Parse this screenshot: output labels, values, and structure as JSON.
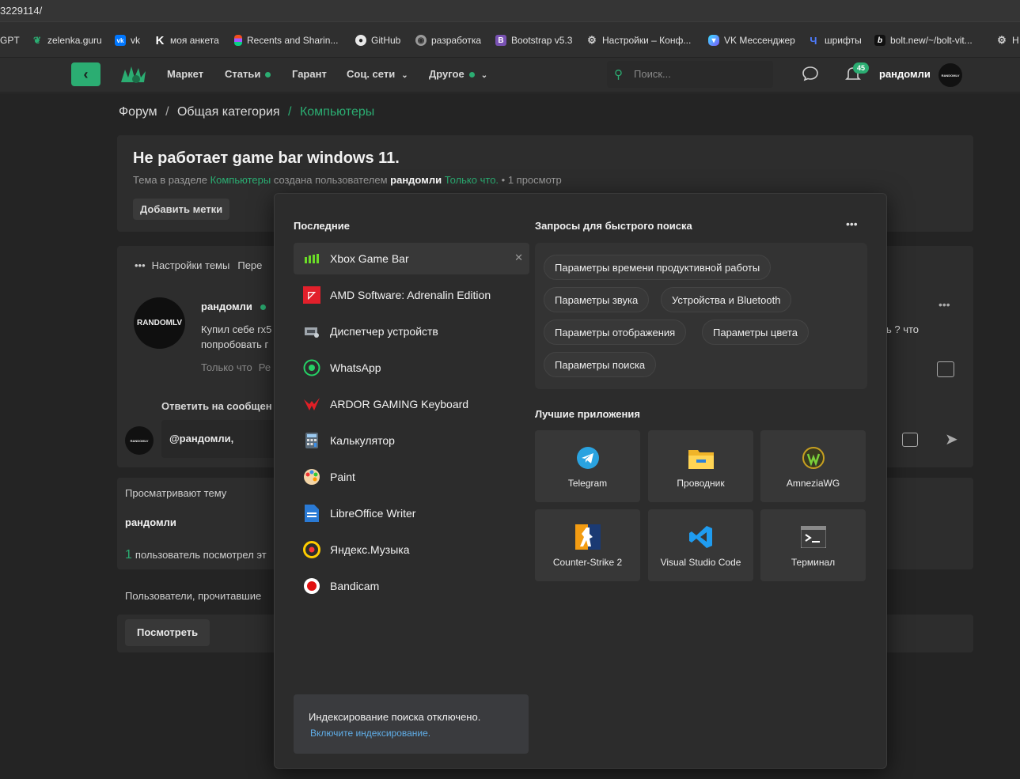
{
  "browser": {
    "url": "3229114/",
    "bookmarks": [
      {
        "label": "GPT",
        "icon": "gpt-icon"
      },
      {
        "label": "zelenka.guru",
        "icon": "zelenka-icon"
      },
      {
        "label": "vk",
        "icon": "vk-icon"
      },
      {
        "label": "моя анкета",
        "icon": "k-icon"
      },
      {
        "label": "Recents and Sharin...",
        "icon": "figma-icon"
      },
      {
        "label": "GitHub",
        "icon": "github-icon"
      },
      {
        "label": "разработка",
        "icon": "chrome-icon"
      },
      {
        "label": "Bootstrap v5.3",
        "icon": "bootstrap-icon"
      },
      {
        "label": "Настройки – Конф...",
        "icon": "gear-icon"
      },
      {
        "label": "VK Мессенджер",
        "icon": "vk-messenger-icon"
      },
      {
        "label": "шрифты",
        "icon": "fonts-icon"
      },
      {
        "label": "bolt.new/~/bolt-vit...",
        "icon": "bolt-icon"
      },
      {
        "label": "Н",
        "icon": "gear-icon"
      }
    ]
  },
  "site": {
    "nav": [
      "Маркет",
      "Статьи",
      "Гарант",
      "Соц. сети",
      "Другое"
    ],
    "search_placeholder": "Поиск...",
    "notifications": "45",
    "username": "рандомли",
    "avatar_text": "RANDOMLV"
  },
  "breadcrumb": [
    "Форум",
    "Общая категория",
    "Компьютеры"
  ],
  "thread": {
    "title": "Не работает game bar windows 11.",
    "meta_prefix": "Тема в разделе",
    "meta_section": "Компьютеры",
    "meta_mid": "создана пользователем",
    "meta_user": "рандомли",
    "meta_time": "Только что.",
    "meta_views": "• 1 просмотр",
    "add_tags": "Добавить метки"
  },
  "post": {
    "settings": "Настройки темы",
    "settings_more": "Пере",
    "author": "рандомли",
    "line1": "Купил себе rx5",
    "line2": "попробовать г",
    "line_right": "ь ? что",
    "time": "Только что",
    "time_more": "Ре",
    "reply_label": "Ответить на сообщен",
    "reply_input": "@рандомли,"
  },
  "viewers": {
    "title": "Просматривают тему",
    "user": "рандомли",
    "count": "1",
    "count_text": "пользователь посмотрел эт",
    "readers": "Пользователи, прочитавшие",
    "view_btn": "Посмотреть"
  },
  "startmenu": {
    "recent_title": "Последние",
    "recent": [
      {
        "label": "Xbox Game Bar",
        "icon": "xbox-game-bar-icon"
      },
      {
        "label": "AMD Software: Adrenalin Edition",
        "icon": "amd-icon"
      },
      {
        "label": "Диспетчер устройств",
        "icon": "device-manager-icon"
      },
      {
        "label": "WhatsApp",
        "icon": "whatsapp-icon"
      },
      {
        "label": "ARDOR GAMING Keyboard",
        "icon": "ardor-icon"
      },
      {
        "label": "Калькулятор",
        "icon": "calculator-icon"
      },
      {
        "label": "Paint",
        "icon": "paint-icon"
      },
      {
        "label": "LibreOffice Writer",
        "icon": "libreoffice-writer-icon"
      },
      {
        "label": "Яндекс.Музыка",
        "icon": "yandex-music-icon"
      },
      {
        "label": "Bandicam",
        "icon": "bandicam-icon"
      }
    ],
    "quick_title": "Запросы для быстрого поиска",
    "quick": [
      "Параметры времени продуктивной работы",
      "Параметры звука",
      "Устройства и Bluetooth",
      "Параметры отображения",
      "Параметры цвета",
      "Параметры поиска"
    ],
    "apps_title": "Лучшие приложения",
    "apps": [
      {
        "label": "Telegram",
        "icon": "telegram-icon"
      },
      {
        "label": "Проводник",
        "icon": "explorer-icon"
      },
      {
        "label": "AmneziaWG",
        "icon": "amneziawg-icon"
      },
      {
        "label": "Counter-Strike 2",
        "icon": "cs2-icon"
      },
      {
        "label": "Visual Studio Code",
        "icon": "vscode-icon"
      },
      {
        "label": "Терминал",
        "icon": "terminal-icon"
      }
    ],
    "index_text": "Индексирование поиска отключено.",
    "index_link": "Включите индексирование."
  },
  "colors": {
    "accent_green": "#2bad72",
    "link_blue": "#60aee8"
  }
}
